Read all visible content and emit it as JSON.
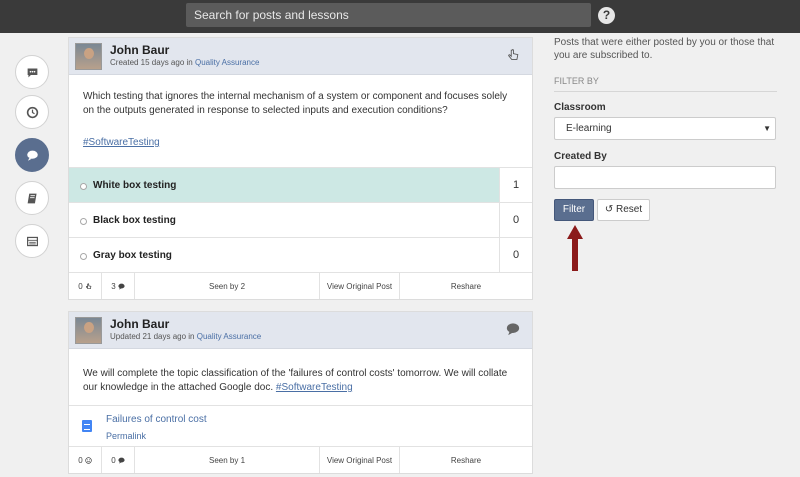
{
  "topbar": {
    "search_placeholder": "Search for posts and lessons",
    "help_label": "?"
  },
  "rail": [
    {
      "icon": "chat-bubble-icon",
      "active": false
    },
    {
      "icon": "clock-icon",
      "active": false
    },
    {
      "icon": "comment-icon",
      "active": true
    },
    {
      "icon": "book-icon",
      "active": false
    },
    {
      "icon": "list-icon",
      "active": false
    }
  ],
  "posts": [
    {
      "author": "John Baur",
      "meta_prefix": "Created 15 days ago in",
      "meta_link": "Quality Assurance",
      "head_icon": "hand-pointer-icon",
      "question": "Which testing that ignores the internal mechanism of a system or component and focuses solely on the outputs generated in response to selected inputs and execution conditions?",
      "hashtag": "#SoftwareTesting",
      "options": [
        {
          "label": "White box testing",
          "count": "1",
          "selected": true
        },
        {
          "label": "Black box testing",
          "count": "0",
          "selected": false
        },
        {
          "label": "Gray box testing",
          "count": "0",
          "selected": false
        }
      ],
      "footer": {
        "likes": "0",
        "comments": "3",
        "seen_by": "Seen by 2",
        "view_original": "View Original Post",
        "reshare": "Reshare"
      }
    },
    {
      "author": "John Baur",
      "meta_prefix": "Updated 21 days ago in",
      "meta_link": "Quality Assurance",
      "head_icon": "comment-icon",
      "text": "We will complete the topic classification of the 'failures of control costs' tomorrow. We will collate our knowledge in the attached Google doc.",
      "hashtag": "#SoftwareTesting",
      "attachment": {
        "title": "Failures of control cost",
        "permalink": "Permalink"
      },
      "footer": {
        "likes": "0",
        "comments": "0",
        "seen_by": "Seen by 1",
        "view_original": "View Original Post",
        "reshare": "Reshare"
      }
    }
  ],
  "filter_panel": {
    "intro": "Posts that were either posted by you or those that you are subscribed to.",
    "filter_by": "FILTER BY",
    "classroom_label": "Classroom",
    "classroom_value": "E-learning",
    "created_by_label": "Created By",
    "created_by_value": "",
    "filter_button": "Filter",
    "reset_button": "Reset",
    "reset_icon": "undo-icon"
  },
  "colors": {
    "topbar": "#3a3a3a",
    "accent": "#5a6e8f",
    "selected_option": "#cde8e4",
    "link": "#4a6fa5",
    "arrow": "#8b1a1a"
  }
}
